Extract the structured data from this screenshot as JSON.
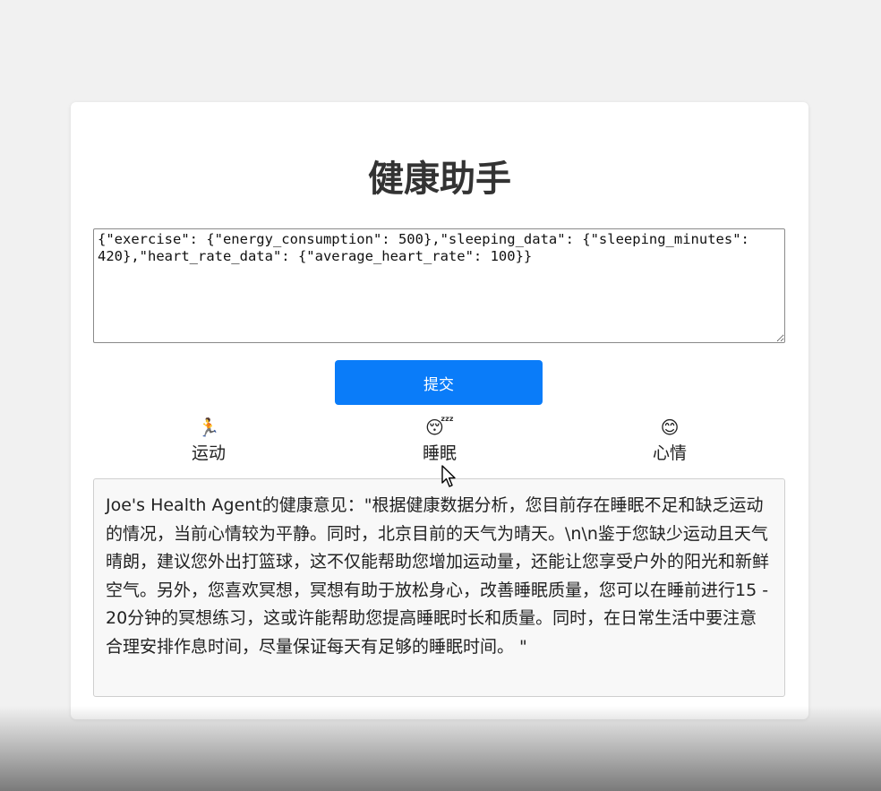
{
  "app": {
    "title": "健康助手"
  },
  "input": {
    "value": "{\"exercise\": {\"energy_consumption\": 500},\"sleeping_data\": {\"sleeping_minutes\": 420},\"heart_rate_data\": {\"average_heart_rate\": 100}}"
  },
  "submit": {
    "label": "提交",
    "color": "#0a7cf9"
  },
  "categories": [
    {
      "icon": "🏃",
      "icon_name": "running-person-icon",
      "label": "运动"
    },
    {
      "icon": "😴",
      "icon_name": "sleeping-face-icon",
      "label": "睡眠"
    },
    {
      "icon": "😊",
      "icon_name": "smiling-face-icon",
      "label": "心情"
    }
  ],
  "result": {
    "text": "Joe's Health Agent的健康意见：\"根据健康数据分析，您目前存在睡眠不足和缺乏运动的情况，当前心情较为平静。同时，北京目前的天气为晴天。\\n\\n鉴于您缺少运动且天气晴朗，建议您外出打篮球，这不仅能帮助您增加运动量，还能让您享受户外的阳光和新鲜空气。另外，您喜欢冥想，冥想有助于放松身心，改善睡眠质量，您可以在睡前进行15 - 20分钟的冥想练习，这或许能帮助您提高睡眠时长和质量。同时，在日常生活中要注意合理安排作息时间，尽量保证每天有足够的睡眠时间。 \""
  }
}
